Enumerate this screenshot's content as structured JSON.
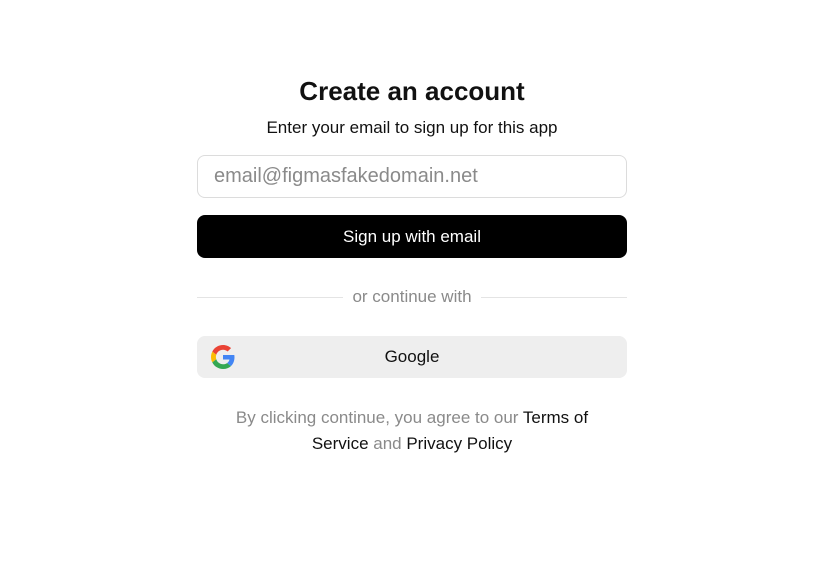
{
  "signup": {
    "title": "Create an account",
    "subtitle": "Enter your email to sign up for this app",
    "email_placeholder": "email@figmasfakedomain.net",
    "email_value": "",
    "signup_button_label": "Sign up with email",
    "divider_text": "or continue with",
    "google_button_label": "Google",
    "google_icon": "google-logo-icon"
  },
  "legal": {
    "prefix": "By clicking continue, you agree to our ",
    "terms_link": "Terms of Service",
    "conjunction": " and ",
    "privacy_link": "Privacy Policy"
  },
  "colors": {
    "primary_button": "#000000",
    "secondary_button": "#eeeeee",
    "muted_text": "#8a8a8a",
    "heading_text": "#111111"
  }
}
